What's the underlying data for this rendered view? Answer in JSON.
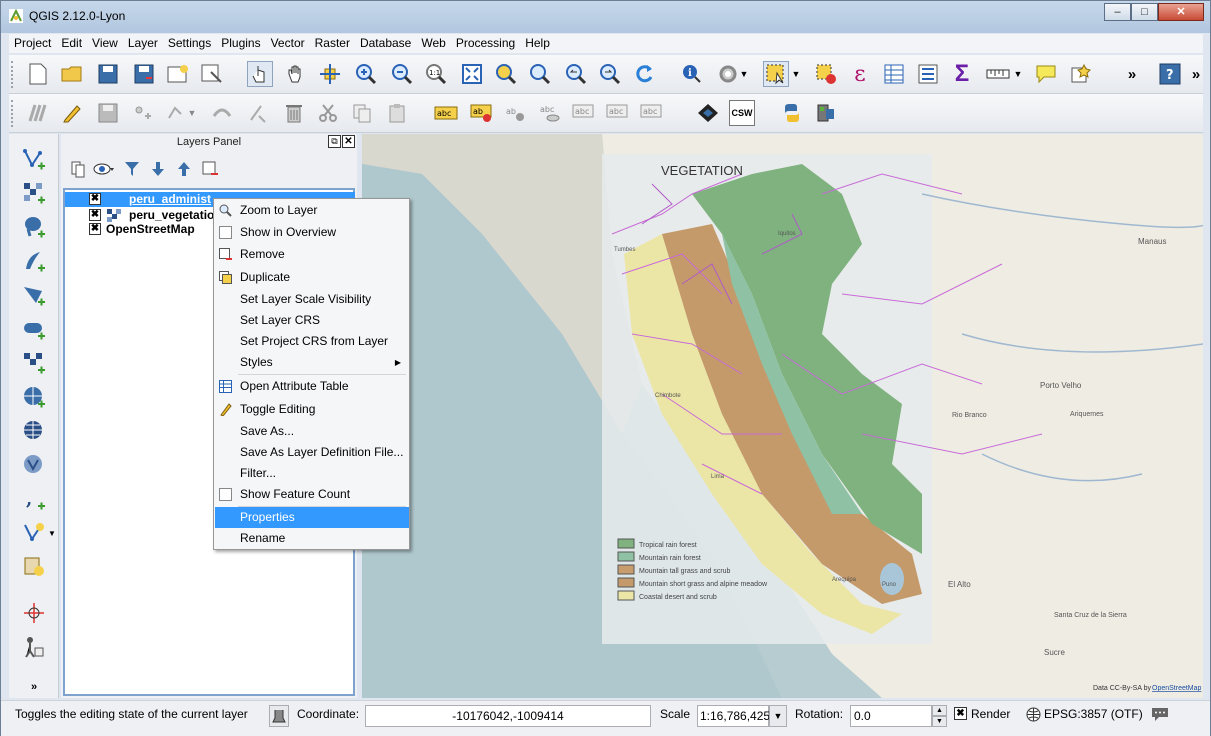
{
  "window": {
    "title": "QGIS 2.12.0-Lyon",
    "minimize": "–",
    "maximize": "□",
    "close": "✕"
  },
  "menubar": [
    "Project",
    "Edit",
    "View",
    "Layer",
    "Settings",
    "Plugins",
    "Vector",
    "Raster",
    "Database",
    "Web",
    "Processing",
    "Help"
  ],
  "toolbar": {
    "overflow": "»",
    "abc": "abc",
    "csw": "CSW",
    "sigma": "Σ",
    "epsilon": "ε",
    "help": "?"
  },
  "layers_panel": {
    "title": "Layers Panel",
    "float_btn": "⧉",
    "close_btn": "✕",
    "layers": [
      {
        "name": "peru_administrative",
        "shown": "peru_administ",
        "checked": "✖",
        "selected": true
      },
      {
        "name": "peru_vegetation",
        "shown": "peru_vegetatio",
        "checked": "✖",
        "selected": false
      },
      {
        "name": "OpenStreetMap",
        "shown": "OpenStreetMap",
        "checked": "✖",
        "selected": false
      }
    ]
  },
  "context_menu": {
    "items": [
      {
        "label": "Zoom to Layer",
        "icon": "zoom-icon"
      },
      {
        "label": "Show in Overview",
        "icon": "checkbox-icon"
      },
      {
        "label": "Remove",
        "icon": "remove-icon"
      },
      {
        "label": "Duplicate",
        "icon": "duplicate-icon"
      },
      {
        "label": "Set Layer Scale Visibility",
        "icon": ""
      },
      {
        "label": "Set Layer CRS",
        "icon": ""
      },
      {
        "label": "Set Project CRS from Layer",
        "icon": ""
      },
      {
        "label": "Styles",
        "icon": "",
        "submenu": "▶"
      },
      {
        "label": "Open Attribute Table",
        "icon": "table-icon"
      },
      {
        "label": "Toggle Editing",
        "icon": "pencil-icon"
      },
      {
        "label": "Save As...",
        "icon": ""
      },
      {
        "label": "Save As Layer Definition File...",
        "icon": ""
      },
      {
        "label": "Filter...",
        "icon": ""
      },
      {
        "label": "Show Feature Count",
        "icon": "checkbox-icon"
      },
      {
        "label": "Properties",
        "icon": "",
        "highlighted": true
      },
      {
        "label": "Rename",
        "icon": ""
      }
    ]
  },
  "map": {
    "legend_title": "VEGETATION",
    "legend": [
      {
        "label": "Tropical rain forest",
        "color": "#7fb27f"
      },
      {
        "label": "Mountain rain forest",
        "color": "#8fc1a5"
      },
      {
        "label": "Mountain tall grass and scrub",
        "color": "#c99c6e"
      },
      {
        "label": "Mountain short grass and alpine meadow",
        "color": "#c49a6a"
      },
      {
        "label": "Coastal desert and scrub",
        "color": "#ece6a6"
      }
    ],
    "places": [
      "Manaus",
      "Porto Velho",
      "Rio Branco",
      "Ariquemes",
      "El Alto",
      "Santa Cruz de la Sierra",
      "Sucre",
      "Chimbote",
      "Lima",
      "Arequipa",
      "Puno",
      "Iquitos",
      "Tumbes"
    ],
    "attribution_prefix": "Data CC-By-SA by ",
    "attribution_link": "OpenStreetMap"
  },
  "statusbar": {
    "message": "Toggles the editing state of the current layer",
    "coordinate_label": "Coordinate:",
    "coordinate_value": "-10176042,-1009414",
    "scale_label": "Scale",
    "scale_value": "1:16,786,425",
    "rotation_label": "Rotation:",
    "rotation_value": "0.0",
    "render_label": "Render",
    "render_checked": "✖",
    "crs_label": "EPSG:3857 (OTF)"
  },
  "colors": {
    "selection": "#3399ff",
    "accent_yellow": "#f5d04a"
  }
}
